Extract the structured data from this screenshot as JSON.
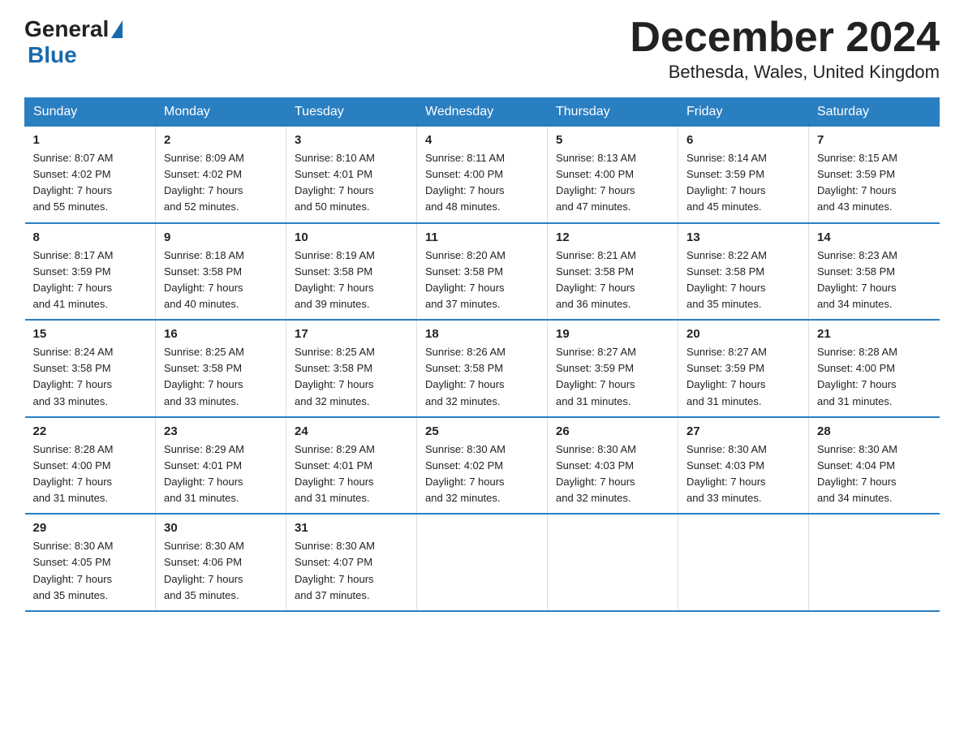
{
  "logo": {
    "general": "General",
    "blue": "Blue"
  },
  "header": {
    "title": "December 2024",
    "location": "Bethesda, Wales, United Kingdom"
  },
  "weekdays": [
    "Sunday",
    "Monday",
    "Tuesday",
    "Wednesday",
    "Thursday",
    "Friday",
    "Saturday"
  ],
  "weeks": [
    [
      {
        "day": "1",
        "sunrise": "8:07 AM",
        "sunset": "4:02 PM",
        "daylight": "7 hours and 55 minutes."
      },
      {
        "day": "2",
        "sunrise": "8:09 AM",
        "sunset": "4:02 PM",
        "daylight": "7 hours and 52 minutes."
      },
      {
        "day": "3",
        "sunrise": "8:10 AM",
        "sunset": "4:01 PM",
        "daylight": "7 hours and 50 minutes."
      },
      {
        "day": "4",
        "sunrise": "8:11 AM",
        "sunset": "4:00 PM",
        "daylight": "7 hours and 48 minutes."
      },
      {
        "day": "5",
        "sunrise": "8:13 AM",
        "sunset": "4:00 PM",
        "daylight": "7 hours and 47 minutes."
      },
      {
        "day": "6",
        "sunrise": "8:14 AM",
        "sunset": "3:59 PM",
        "daylight": "7 hours and 45 minutes."
      },
      {
        "day": "7",
        "sunrise": "8:15 AM",
        "sunset": "3:59 PM",
        "daylight": "7 hours and 43 minutes."
      }
    ],
    [
      {
        "day": "8",
        "sunrise": "8:17 AM",
        "sunset": "3:59 PM",
        "daylight": "7 hours and 41 minutes."
      },
      {
        "day": "9",
        "sunrise": "8:18 AM",
        "sunset": "3:58 PM",
        "daylight": "7 hours and 40 minutes."
      },
      {
        "day": "10",
        "sunrise": "8:19 AM",
        "sunset": "3:58 PM",
        "daylight": "7 hours and 39 minutes."
      },
      {
        "day": "11",
        "sunrise": "8:20 AM",
        "sunset": "3:58 PM",
        "daylight": "7 hours and 37 minutes."
      },
      {
        "day": "12",
        "sunrise": "8:21 AM",
        "sunset": "3:58 PM",
        "daylight": "7 hours and 36 minutes."
      },
      {
        "day": "13",
        "sunrise": "8:22 AM",
        "sunset": "3:58 PM",
        "daylight": "7 hours and 35 minutes."
      },
      {
        "day": "14",
        "sunrise": "8:23 AM",
        "sunset": "3:58 PM",
        "daylight": "7 hours and 34 minutes."
      }
    ],
    [
      {
        "day": "15",
        "sunrise": "8:24 AM",
        "sunset": "3:58 PM",
        "daylight": "7 hours and 33 minutes."
      },
      {
        "day": "16",
        "sunrise": "8:25 AM",
        "sunset": "3:58 PM",
        "daylight": "7 hours and 33 minutes."
      },
      {
        "day": "17",
        "sunrise": "8:25 AM",
        "sunset": "3:58 PM",
        "daylight": "7 hours and 32 minutes."
      },
      {
        "day": "18",
        "sunrise": "8:26 AM",
        "sunset": "3:58 PM",
        "daylight": "7 hours and 32 minutes."
      },
      {
        "day": "19",
        "sunrise": "8:27 AM",
        "sunset": "3:59 PM",
        "daylight": "7 hours and 31 minutes."
      },
      {
        "day": "20",
        "sunrise": "8:27 AM",
        "sunset": "3:59 PM",
        "daylight": "7 hours and 31 minutes."
      },
      {
        "day": "21",
        "sunrise": "8:28 AM",
        "sunset": "4:00 PM",
        "daylight": "7 hours and 31 minutes."
      }
    ],
    [
      {
        "day": "22",
        "sunrise": "8:28 AM",
        "sunset": "4:00 PM",
        "daylight": "7 hours and 31 minutes."
      },
      {
        "day": "23",
        "sunrise": "8:29 AM",
        "sunset": "4:01 PM",
        "daylight": "7 hours and 31 minutes."
      },
      {
        "day": "24",
        "sunrise": "8:29 AM",
        "sunset": "4:01 PM",
        "daylight": "7 hours and 31 minutes."
      },
      {
        "day": "25",
        "sunrise": "8:30 AM",
        "sunset": "4:02 PM",
        "daylight": "7 hours and 32 minutes."
      },
      {
        "day": "26",
        "sunrise": "8:30 AM",
        "sunset": "4:03 PM",
        "daylight": "7 hours and 32 minutes."
      },
      {
        "day": "27",
        "sunrise": "8:30 AM",
        "sunset": "4:03 PM",
        "daylight": "7 hours and 33 minutes."
      },
      {
        "day": "28",
        "sunrise": "8:30 AM",
        "sunset": "4:04 PM",
        "daylight": "7 hours and 34 minutes."
      }
    ],
    [
      {
        "day": "29",
        "sunrise": "8:30 AM",
        "sunset": "4:05 PM",
        "daylight": "7 hours and 35 minutes."
      },
      {
        "day": "30",
        "sunrise": "8:30 AM",
        "sunset": "4:06 PM",
        "daylight": "7 hours and 35 minutes."
      },
      {
        "day": "31",
        "sunrise": "8:30 AM",
        "sunset": "4:07 PM",
        "daylight": "7 hours and 37 minutes."
      },
      null,
      null,
      null,
      null
    ]
  ],
  "labels": {
    "sunrise": "Sunrise:",
    "sunset": "Sunset:",
    "daylight": "Daylight:"
  }
}
